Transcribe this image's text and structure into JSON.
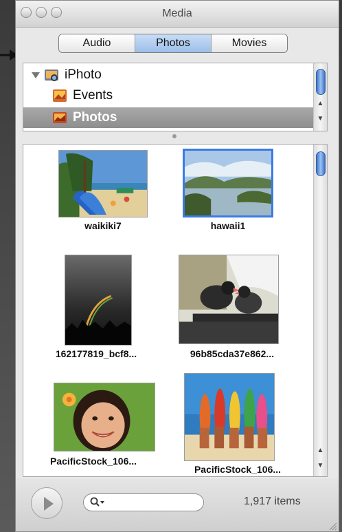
{
  "window": {
    "title": "Media"
  },
  "tabs": [
    {
      "label": "Audio",
      "active": false
    },
    {
      "label": "Photos",
      "active": true
    },
    {
      "label": "Movies",
      "active": false
    }
  ],
  "source_list": [
    {
      "label": "iPhoto",
      "icon": "iphoto-icon",
      "expanded": true
    },
    {
      "label": "Events",
      "icon": "events-icon"
    },
    {
      "label": "Photos",
      "icon": "photos-icon",
      "selected": true
    }
  ],
  "photos": [
    {
      "name": "waikiki7",
      "selected": false
    },
    {
      "name": "hawaii1",
      "selected": true
    },
    {
      "name": "162177819_bcf8...",
      "selected": false
    },
    {
      "name": "96b85cda37e862...",
      "selected": false
    },
    {
      "name": "PacificStock_106...",
      "selected": false
    },
    {
      "name": "PacificStock_106...",
      "selected": false
    }
  ],
  "footer": {
    "item_count": "1,917 items",
    "search_value": ""
  },
  "colors": {
    "accent": "#3b7ae6",
    "selection_row": "#9a9a9a",
    "scroll_thumb": "#4a7fd0"
  }
}
